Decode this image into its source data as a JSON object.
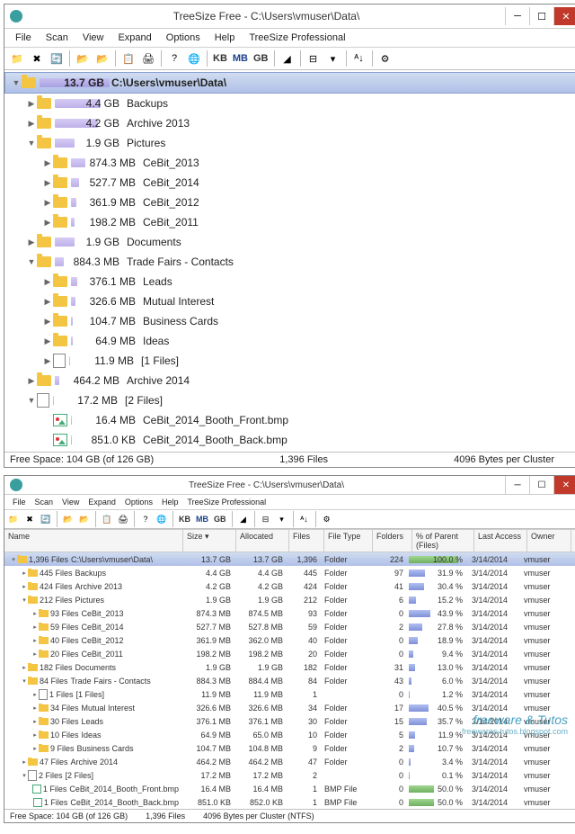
{
  "window1": {
    "title": "TreeSize Free - C:\\Users\\vmuser\\Data\\",
    "menus": [
      "File",
      "Scan",
      "View",
      "Expand",
      "Options",
      "Help",
      "TreeSize Professional"
    ],
    "units": [
      "KB",
      "MB",
      "GB"
    ],
    "status": {
      "free": "Free Space: 104 GB  (of 126 GB)",
      "files": "1,396  Files",
      "cluster": "4096 Bytes per Cluster"
    },
    "tree": [
      {
        "lvl": 0,
        "exp": "▼",
        "ico": "folder",
        "size": "13.7 GB",
        "barw": 100,
        "name": "C:\\Users\\vmuser\\Data\\",
        "sel": true
      },
      {
        "lvl": 1,
        "exp": "▶",
        "ico": "folder",
        "size": "4.4 GB",
        "barw": 65,
        "name": "Backups"
      },
      {
        "lvl": 1,
        "exp": "▶",
        "ico": "folder",
        "size": "4.2 GB",
        "barw": 62,
        "name": "Archive 2013"
      },
      {
        "lvl": 1,
        "exp": "▼",
        "ico": "folder",
        "size": "1.9 GB",
        "barw": 28,
        "name": "Pictures"
      },
      {
        "lvl": 2,
        "exp": "▶",
        "ico": "folder",
        "size": "874.3 MB",
        "barw": 20,
        "name": "CeBit_2013"
      },
      {
        "lvl": 2,
        "exp": "▶",
        "ico": "folder",
        "size": "527.7 MB",
        "barw": 12,
        "name": "CeBit_2014"
      },
      {
        "lvl": 2,
        "exp": "▶",
        "ico": "folder",
        "size": "361.9 MB",
        "barw": 8,
        "name": "CeBit_2012"
      },
      {
        "lvl": 2,
        "exp": "▶",
        "ico": "folder",
        "size": "198.2 MB",
        "barw": 5,
        "name": "CeBit_2011"
      },
      {
        "lvl": 1,
        "exp": "▶",
        "ico": "folder",
        "size": "1.9 GB",
        "barw": 28,
        "name": "Documents"
      },
      {
        "lvl": 1,
        "exp": "▼",
        "ico": "folder",
        "size": "884.3 MB",
        "barw": 13,
        "name": "Trade Fairs - Contacts"
      },
      {
        "lvl": 2,
        "exp": "▶",
        "ico": "folder",
        "size": "376.1 MB",
        "barw": 9,
        "name": "Leads"
      },
      {
        "lvl": 2,
        "exp": "▶",
        "ico": "folder",
        "size": "326.6 MB",
        "barw": 7,
        "name": "Mutual Interest"
      },
      {
        "lvl": 2,
        "exp": "▶",
        "ico": "folder",
        "size": "104.7 MB",
        "barw": 3,
        "name": "Business Cards"
      },
      {
        "lvl": 2,
        "exp": "▶",
        "ico": "folder",
        "size": "64.9 MB",
        "barw": 2,
        "name": "Ideas"
      },
      {
        "lvl": 2,
        "exp": "▶",
        "ico": "page",
        "size": "11.9 MB",
        "barw": 1,
        "name": "[1 Files]"
      },
      {
        "lvl": 1,
        "exp": "▶",
        "ico": "folder",
        "size": "464.2 MB",
        "barw": 7,
        "name": "Archive 2014"
      },
      {
        "lvl": 1,
        "exp": "▼",
        "ico": "page",
        "size": "17.2 MB",
        "barw": 1,
        "name": "[2 Files]"
      },
      {
        "lvl": 2,
        "exp": "",
        "ico": "img",
        "size": "16.4 MB",
        "barw": 1,
        "name": "CeBit_2014_Booth_Front.bmp"
      },
      {
        "lvl": 2,
        "exp": "",
        "ico": "img",
        "size": "851.0 KB",
        "barw": 1,
        "name": "CeBit_2014_Booth_Back.bmp"
      }
    ]
  },
  "window2": {
    "title": "TreeSize Free - C:\\Users\\vmuser\\Data\\",
    "menus": [
      "File",
      "Scan",
      "View",
      "Expand",
      "Options",
      "Help",
      "TreeSize Professional"
    ],
    "units": [
      "KB",
      "MB",
      "GB"
    ],
    "columns": [
      "Name",
      "Size ▾",
      "Allocated",
      "Files",
      "File Type",
      "Folders",
      "% of Parent (Files)",
      "Last Access",
      "Owner"
    ],
    "status": {
      "free": "Free Space: 104 GB  (of 126 GB)",
      "files": "1,396  Files",
      "cluster": "4096 Bytes per Cluster (NTFS)"
    },
    "rows": [
      {
        "lvl": 0,
        "exp": "▾",
        "ico": "folder",
        "namepre": "1,396 Files",
        "name": "C:\\Users\\vmuser\\Data\\",
        "size": "13.7 GB",
        "alloc": "13.7 GB",
        "files": "1,396",
        "type": "Folder",
        "fold": "224",
        "pct": "100.0 %",
        "pbar": 100,
        "g": true,
        "last": "3/14/2014",
        "own": "vmuser",
        "sel": true
      },
      {
        "lvl": 1,
        "exp": "▸",
        "ico": "folder",
        "namepre": "445 Files",
        "name": "Backups",
        "size": "4.4 GB",
        "alloc": "4.4 GB",
        "files": "445",
        "type": "Folder",
        "fold": "97",
        "pct": "31.9 %",
        "pbar": 32,
        "last": "3/14/2014",
        "own": "vmuser"
      },
      {
        "lvl": 1,
        "exp": "▸",
        "ico": "folder",
        "namepre": "424 Files",
        "name": "Archive 2013",
        "size": "4.2 GB",
        "alloc": "4.2 GB",
        "files": "424",
        "type": "Folder",
        "fold": "41",
        "pct": "30.4 %",
        "pbar": 30,
        "last": "3/14/2014",
        "own": "vmuser"
      },
      {
        "lvl": 1,
        "exp": "▾",
        "ico": "folder",
        "namepre": "212 Files",
        "name": "Pictures",
        "size": "1.9 GB",
        "alloc": "1.9 GB",
        "files": "212",
        "type": "Folder",
        "fold": "6",
        "pct": "15.2 %",
        "pbar": 15,
        "last": "3/14/2014",
        "own": "vmuser"
      },
      {
        "lvl": 2,
        "exp": "▸",
        "ico": "folder",
        "namepre": "93 Files",
        "name": "CeBit_2013",
        "size": "874.3 MB",
        "alloc": "874.5 MB",
        "files": "93",
        "type": "Folder",
        "fold": "0",
        "pct": "43.9 %",
        "pbar": 44,
        "last": "3/14/2014",
        "own": "vmuser"
      },
      {
        "lvl": 2,
        "exp": "▸",
        "ico": "folder",
        "namepre": "59 Files",
        "name": "CeBit_2014",
        "size": "527.7 MB",
        "alloc": "527.8 MB",
        "files": "59",
        "type": "Folder",
        "fold": "2",
        "pct": "27.8 %",
        "pbar": 28,
        "last": "3/14/2014",
        "own": "vmuser"
      },
      {
        "lvl": 2,
        "exp": "▸",
        "ico": "folder",
        "namepre": "40 Files",
        "name": "CeBit_2012",
        "size": "361.9 MB",
        "alloc": "362.0 MB",
        "files": "40",
        "type": "Folder",
        "fold": "0",
        "pct": "18.9 %",
        "pbar": 19,
        "last": "3/14/2014",
        "own": "vmuser"
      },
      {
        "lvl": 2,
        "exp": "▸",
        "ico": "folder",
        "namepre": "20 Files",
        "name": "CeBit_2011",
        "size": "198.2 MB",
        "alloc": "198.2 MB",
        "files": "20",
        "type": "Folder",
        "fold": "0",
        "pct": "9.4 %",
        "pbar": 9,
        "last": "3/14/2014",
        "own": "vmuser"
      },
      {
        "lvl": 1,
        "exp": "▸",
        "ico": "folder",
        "namepre": "182 Files",
        "name": "Documents",
        "size": "1.9 GB",
        "alloc": "1.9 GB",
        "files": "182",
        "type": "Folder",
        "fold": "31",
        "pct": "13.0 %",
        "pbar": 13,
        "last": "3/14/2014",
        "own": "vmuser"
      },
      {
        "lvl": 1,
        "exp": "▾",
        "ico": "folder",
        "namepre": "84 Files",
        "name": "Trade Fairs - Contacts",
        "size": "884.3 MB",
        "alloc": "884.4 MB",
        "files": "84",
        "type": "Folder",
        "fold": "43",
        "pct": "6.0 %",
        "pbar": 6,
        "last": "3/14/2014",
        "own": "vmuser"
      },
      {
        "lvl": 2,
        "exp": "▸",
        "ico": "page",
        "namepre": "1 Files",
        "name": "[1 Files]",
        "size": "11.9 MB",
        "alloc": "11.9 MB",
        "files": "1",
        "type": "",
        "fold": "0",
        "pct": "1.2 %",
        "pbar": 1,
        "last": "3/14/2014",
        "own": "vmuser"
      },
      {
        "lvl": 2,
        "exp": "▸",
        "ico": "folder",
        "namepre": "34 Files",
        "name": "Mutual Interest",
        "size": "326.6 MB",
        "alloc": "326.6 MB",
        "files": "34",
        "type": "Folder",
        "fold": "17",
        "pct": "40.5 %",
        "pbar": 40,
        "last": "3/14/2014",
        "own": "vmuser"
      },
      {
        "lvl": 2,
        "exp": "▸",
        "ico": "folder",
        "namepre": "30 Files",
        "name": "Leads",
        "size": "376.1 MB",
        "alloc": "376.1 MB",
        "files": "30",
        "type": "Folder",
        "fold": "15",
        "pct": "35.7 %",
        "pbar": 36,
        "last": "3/14/2014",
        "own": "vmuser"
      },
      {
        "lvl": 2,
        "exp": "▸",
        "ico": "folder",
        "namepre": "10 Files",
        "name": "Ideas",
        "size": "64.9 MB",
        "alloc": "65.0 MB",
        "files": "10",
        "type": "Folder",
        "fold": "5",
        "pct": "11.9 %",
        "pbar": 12,
        "last": "3/14/2014",
        "own": "vmuser"
      },
      {
        "lvl": 2,
        "exp": "▸",
        "ico": "folder",
        "namepre": "9 Files",
        "name": "Business Cards",
        "size": "104.7 MB",
        "alloc": "104.8 MB",
        "files": "9",
        "type": "Folder",
        "fold": "2",
        "pct": "10.7 %",
        "pbar": 11,
        "last": "3/14/2014",
        "own": "vmuser"
      },
      {
        "lvl": 1,
        "exp": "▸",
        "ico": "folder",
        "namepre": "47 Files",
        "name": "Archive 2014",
        "size": "464.2 MB",
        "alloc": "464.2 MB",
        "files": "47",
        "type": "Folder",
        "fold": "0",
        "pct": "3.4 %",
        "pbar": 3,
        "last": "3/14/2014",
        "own": "vmuser"
      },
      {
        "lvl": 1,
        "exp": "▾",
        "ico": "page",
        "namepre": "2 Files",
        "name": "[2 Files]",
        "size": "17.2 MB",
        "alloc": "17.2 MB",
        "files": "2",
        "type": "",
        "fold": "0",
        "pct": "0.1 %",
        "pbar": 1,
        "last": "3/14/2014",
        "own": "vmuser"
      },
      {
        "lvl": 2,
        "exp": "",
        "ico": "img",
        "namepre": "1 Files",
        "name": "CeBit_2014_Booth_Front.bmp",
        "size": "16.4 MB",
        "alloc": "16.4 MB",
        "files": "1",
        "type": "BMP File",
        "fold": "0",
        "pct": "50.0 %",
        "pbar": 50,
        "g": true,
        "last": "3/14/2014",
        "own": "vmuser"
      },
      {
        "lvl": 2,
        "exp": "",
        "ico": "img",
        "namepre": "1 Files",
        "name": "CeBit_2014_Booth_Back.bmp",
        "size": "851.0 KB",
        "alloc": "852.0 KB",
        "files": "1",
        "type": "BMP File",
        "fold": "0",
        "pct": "50.0 %",
        "pbar": 50,
        "g": true,
        "last": "3/14/2014",
        "own": "vmuser"
      }
    ]
  },
  "watermark": {
    "line1": "freeware & Tutos",
    "line2": "freewares-tutos.blogspot.com"
  }
}
